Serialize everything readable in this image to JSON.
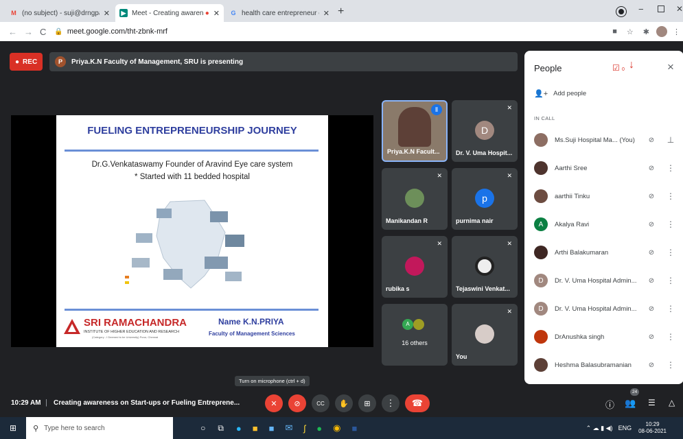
{
  "browser": {
    "tabs": [
      {
        "title": "(no subject) - suji@drngpasc.ac.i"
      },
      {
        "title": "Meet - Creating awareness o"
      },
      {
        "title": "health care entrepreneur coimb"
      }
    ],
    "new_tab": "+",
    "url": "meet.google.com/tht-zbnk-mrf"
  },
  "meet": {
    "rec_label": "REC",
    "presenter_initial": "P",
    "presenting_text": "Priya.K.N Faculty of Management, SRU is presenting"
  },
  "slide": {
    "title": "FUELING ENTREPRENEURSHIP JOURNEY",
    "line1": "Dr.G.Venkataswamy  Founder of Aravind Eye care system",
    "line2": "* Started with 11 bedded hospital",
    "brand_name": "SRI RAMACHANDRA",
    "brand_sub": "INSTITUTE OF HIGHER EDUCATION AND RESEARCH",
    "brand_sub2": "(Category - I Deemed to be University) Porur, Chennai",
    "presenter_name": "Name K.N.PRIYA",
    "presenter_dept": "Faculty of Management Sciences"
  },
  "tiles": [
    {
      "name": "Priya.K.N Facult...",
      "initial": "",
      "color": "#8d6e63"
    },
    {
      "name": "Dr. V. Uma Hospit...",
      "initial": "D",
      "color": "#a1887f"
    },
    {
      "name": "Manikandan R",
      "initial": "",
      "color": "#5d4037"
    },
    {
      "name": "purnima nair",
      "initial": "p",
      "color": "#1a73e8"
    },
    {
      "name": "rubika s",
      "initial": "",
      "color": "#c2185b"
    },
    {
      "name": "Tejaswini Venkat...",
      "initial": "",
      "color": "#eeeeee"
    },
    {
      "name": "16 others",
      "initial": "A",
      "color": "#34a853"
    },
    {
      "name": "You",
      "initial": "",
      "color": "#d7ccc8"
    }
  ],
  "people_panel": {
    "title": "People",
    "badge_count": "0",
    "add_people": "Add people",
    "section": "IN CALL",
    "close": "×",
    "participants": [
      {
        "name": "Ms.Suji Hospital Ma... (You)",
        "initial": "",
        "color": "#8d6e63"
      },
      {
        "name": "Aarthi Sree",
        "initial": "",
        "color": "#4e342e"
      },
      {
        "name": "aarthii Tinku",
        "initial": "",
        "color": "#6d4c41"
      },
      {
        "name": "Akalya Ravi",
        "initial": "A",
        "color": "#0b8043"
      },
      {
        "name": "Arthi Balakumaran",
        "initial": "",
        "color": "#3e2723"
      },
      {
        "name": "Dr. V. Uma Hospital Admin...",
        "initial": "D",
        "color": "#a1887f"
      },
      {
        "name": "Dr. V. Uma Hospital Admin...",
        "initial": "D",
        "color": "#a1887f"
      },
      {
        "name": "DrAnushka singh",
        "initial": "",
        "color": "#bf360c"
      },
      {
        "name": "Heshma Balasubramanian",
        "initial": "",
        "color": "#5d4037"
      }
    ]
  },
  "controls": {
    "time": "10:29 AM",
    "separator": "|",
    "meeting_title": "Creating awareness on Start-ups or Fueling Entreprene...",
    "tooltip": "Turn on microphone (ctrl + d)",
    "people_count": "24"
  },
  "taskbar": {
    "search_placeholder": "Type here to search",
    "lang": "ENG",
    "clock_time": "10:29",
    "clock_date": "08-06-2021"
  },
  "colors": {
    "meet_bg": "#202124",
    "red": "#ea4335",
    "blue": "#1a73e8"
  }
}
